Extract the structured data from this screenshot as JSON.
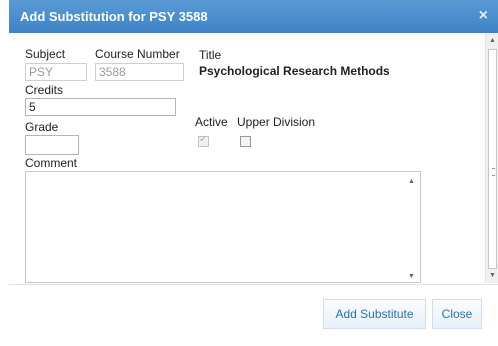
{
  "dialog": {
    "title": "Add Substitution for PSY 3588",
    "close_glyph": "×"
  },
  "form": {
    "subject_label": "Subject",
    "subject_value": "PSY",
    "course_number_label": "Course Number",
    "course_number_value": "3588",
    "title_label": "Title",
    "title_value": "Psychological Research Methods",
    "credits_label": "Credits",
    "credits_value": "5",
    "grade_label": "Grade",
    "grade_value": "",
    "active_label": "Active",
    "active_checked": true,
    "upper_division_label": "Upper Division",
    "upper_division_checked": false,
    "comment_label": "Comment",
    "comment_value": ""
  },
  "footer": {
    "add_substitute_label": "Add Substitute",
    "close_label": "Close"
  },
  "icons": {
    "dialog_close": "close-icon",
    "scroll_up": "scroll-up-arrow-icon",
    "scroll_down": "scroll-down-arrow-icon"
  },
  "colors": {
    "titlebar": "#4a8fd0",
    "button_text": "#2f6fae"
  }
}
